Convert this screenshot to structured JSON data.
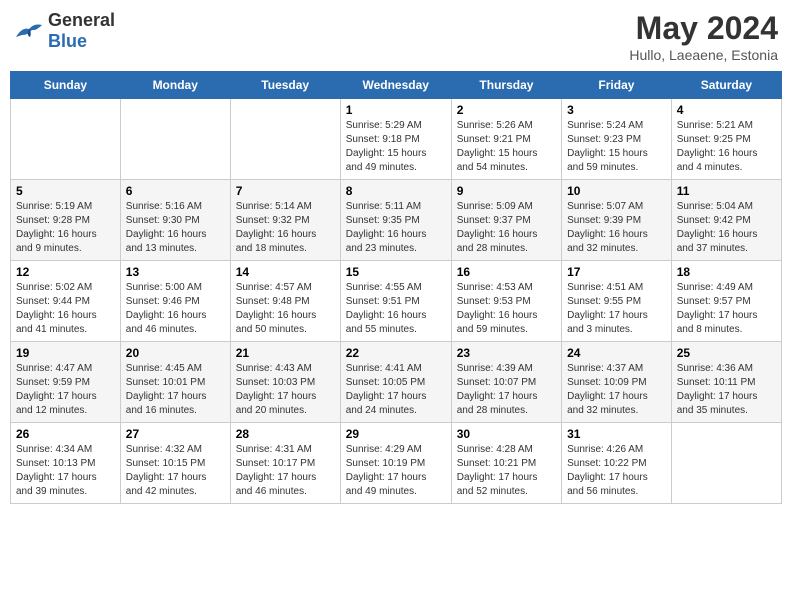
{
  "header": {
    "logo_general": "General",
    "logo_blue": "Blue",
    "month": "May 2024",
    "location": "Hullo, Laeaene, Estonia"
  },
  "weekdays": [
    "Sunday",
    "Monday",
    "Tuesday",
    "Wednesday",
    "Thursday",
    "Friday",
    "Saturday"
  ],
  "weeks": [
    [
      {
        "day": "",
        "sunrise": "",
        "sunset": "",
        "daylight": ""
      },
      {
        "day": "",
        "sunrise": "",
        "sunset": "",
        "daylight": ""
      },
      {
        "day": "",
        "sunrise": "",
        "sunset": "",
        "daylight": ""
      },
      {
        "day": "1",
        "sunrise": "5:29 AM",
        "sunset": "9:18 PM",
        "daylight": "15 hours and 49 minutes."
      },
      {
        "day": "2",
        "sunrise": "5:26 AM",
        "sunset": "9:21 PM",
        "daylight": "15 hours and 54 minutes."
      },
      {
        "day": "3",
        "sunrise": "5:24 AM",
        "sunset": "9:23 PM",
        "daylight": "15 hours and 59 minutes."
      },
      {
        "day": "4",
        "sunrise": "5:21 AM",
        "sunset": "9:25 PM",
        "daylight": "16 hours and 4 minutes."
      }
    ],
    [
      {
        "day": "5",
        "sunrise": "5:19 AM",
        "sunset": "9:28 PM",
        "daylight": "16 hours and 9 minutes."
      },
      {
        "day": "6",
        "sunrise": "5:16 AM",
        "sunset": "9:30 PM",
        "daylight": "16 hours and 13 minutes."
      },
      {
        "day": "7",
        "sunrise": "5:14 AM",
        "sunset": "9:32 PM",
        "daylight": "16 hours and 18 minutes."
      },
      {
        "day": "8",
        "sunrise": "5:11 AM",
        "sunset": "9:35 PM",
        "daylight": "16 hours and 23 minutes."
      },
      {
        "day": "9",
        "sunrise": "5:09 AM",
        "sunset": "9:37 PM",
        "daylight": "16 hours and 28 minutes."
      },
      {
        "day": "10",
        "sunrise": "5:07 AM",
        "sunset": "9:39 PM",
        "daylight": "16 hours and 32 minutes."
      },
      {
        "day": "11",
        "sunrise": "5:04 AM",
        "sunset": "9:42 PM",
        "daylight": "16 hours and 37 minutes."
      }
    ],
    [
      {
        "day": "12",
        "sunrise": "5:02 AM",
        "sunset": "9:44 PM",
        "daylight": "16 hours and 41 minutes."
      },
      {
        "day": "13",
        "sunrise": "5:00 AM",
        "sunset": "9:46 PM",
        "daylight": "16 hours and 46 minutes."
      },
      {
        "day": "14",
        "sunrise": "4:57 AM",
        "sunset": "9:48 PM",
        "daylight": "16 hours and 50 minutes."
      },
      {
        "day": "15",
        "sunrise": "4:55 AM",
        "sunset": "9:51 PM",
        "daylight": "16 hours and 55 minutes."
      },
      {
        "day": "16",
        "sunrise": "4:53 AM",
        "sunset": "9:53 PM",
        "daylight": "16 hours and 59 minutes."
      },
      {
        "day": "17",
        "sunrise": "4:51 AM",
        "sunset": "9:55 PM",
        "daylight": "17 hours and 3 minutes."
      },
      {
        "day": "18",
        "sunrise": "4:49 AM",
        "sunset": "9:57 PM",
        "daylight": "17 hours and 8 minutes."
      }
    ],
    [
      {
        "day": "19",
        "sunrise": "4:47 AM",
        "sunset": "9:59 PM",
        "daylight": "17 hours and 12 minutes."
      },
      {
        "day": "20",
        "sunrise": "4:45 AM",
        "sunset": "10:01 PM",
        "daylight": "17 hours and 16 minutes."
      },
      {
        "day": "21",
        "sunrise": "4:43 AM",
        "sunset": "10:03 PM",
        "daylight": "17 hours and 20 minutes."
      },
      {
        "day": "22",
        "sunrise": "4:41 AM",
        "sunset": "10:05 PM",
        "daylight": "17 hours and 24 minutes."
      },
      {
        "day": "23",
        "sunrise": "4:39 AM",
        "sunset": "10:07 PM",
        "daylight": "17 hours and 28 minutes."
      },
      {
        "day": "24",
        "sunrise": "4:37 AM",
        "sunset": "10:09 PM",
        "daylight": "17 hours and 32 minutes."
      },
      {
        "day": "25",
        "sunrise": "4:36 AM",
        "sunset": "10:11 PM",
        "daylight": "17 hours and 35 minutes."
      }
    ],
    [
      {
        "day": "26",
        "sunrise": "4:34 AM",
        "sunset": "10:13 PM",
        "daylight": "17 hours and 39 minutes."
      },
      {
        "day": "27",
        "sunrise": "4:32 AM",
        "sunset": "10:15 PM",
        "daylight": "17 hours and 42 minutes."
      },
      {
        "day": "28",
        "sunrise": "4:31 AM",
        "sunset": "10:17 PM",
        "daylight": "17 hours and 46 minutes."
      },
      {
        "day": "29",
        "sunrise": "4:29 AM",
        "sunset": "10:19 PM",
        "daylight": "17 hours and 49 minutes."
      },
      {
        "day": "30",
        "sunrise": "4:28 AM",
        "sunset": "10:21 PM",
        "daylight": "17 hours and 52 minutes."
      },
      {
        "day": "31",
        "sunrise": "4:26 AM",
        "sunset": "10:22 PM",
        "daylight": "17 hours and 56 minutes."
      },
      {
        "day": "",
        "sunrise": "",
        "sunset": "",
        "daylight": ""
      }
    ]
  ]
}
